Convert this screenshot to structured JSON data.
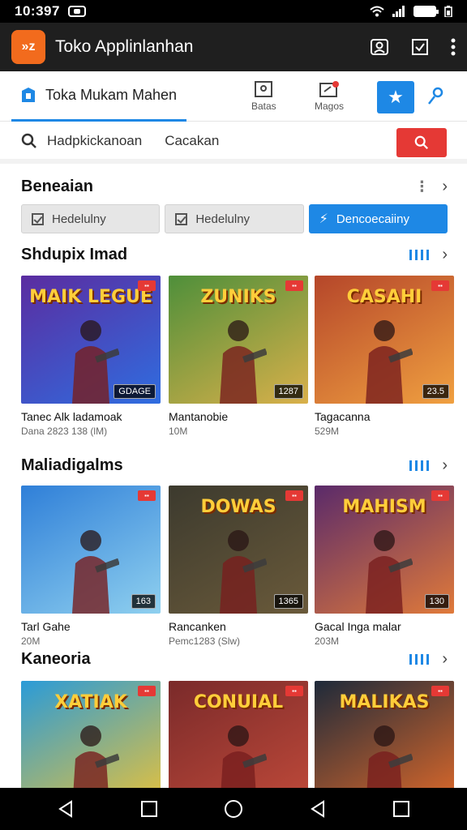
{
  "status": {
    "time": "10:397"
  },
  "app": {
    "title": "Toko Applinlanhan",
    "logo_text": "»z"
  },
  "tabs": {
    "active_label": "Toka Mukam Mahen",
    "batas_label": "Batas",
    "magos_label": "Magos"
  },
  "search": {
    "query": "Hadpkickanoan",
    "secondary": "Cacakan"
  },
  "section1": {
    "title": "Beneaian",
    "filters": [
      "Hedelulny",
      "Hedelulny",
      "Dencoecaiiny"
    ]
  },
  "section2": {
    "title": "Shdupix Imad",
    "cards": [
      {
        "name": "Tanec Alk ladamoak",
        "meta": "Dana 2823 138 (lM)",
        "logo": "MAIK LEGUE",
        "rating": "GDAGE",
        "colors": [
          "#5b2ca0",
          "#2f6de0"
        ]
      },
      {
        "name": "Mantanobie",
        "meta": "10M",
        "logo": "ZUNIKS",
        "rating": "1287",
        "colors": [
          "#4e8f3a",
          "#d9b04a"
        ]
      },
      {
        "name": "Tagacanna",
        "meta": "529M",
        "logo": "CASAHI",
        "rating": "23.5",
        "colors": [
          "#b5462a",
          "#f0a040"
        ]
      }
    ]
  },
  "section3": {
    "title": "Maliadigalms",
    "cards": [
      {
        "name": "Tarl Gahe",
        "meta": "20M",
        "logo": "",
        "rating": "163",
        "colors": [
          "#2f7fd8",
          "#8fd0ef"
        ]
      },
      {
        "name": "Rancanken",
        "meta": "Pemc1283 (Slw)",
        "logo": "DOWAS",
        "rating": "1365",
        "colors": [
          "#3c3a2e",
          "#6a5a3a"
        ]
      },
      {
        "name": "Gacal Inga malar",
        "meta": "203M",
        "logo": "MAHISM",
        "rating": "130",
        "colors": [
          "#5a2a6a",
          "#e07a3a"
        ]
      }
    ]
  },
  "section4": {
    "title": "Kaneoria",
    "cards": [
      {
        "name": "",
        "meta": "",
        "logo": "XATIAK",
        "rating": "",
        "colors": [
          "#2a9bd8",
          "#e8c23a"
        ]
      },
      {
        "name": "",
        "meta": "",
        "logo": "CONUIAL",
        "rating": "",
        "colors": [
          "#7a2a2a",
          "#c04a3a"
        ]
      },
      {
        "name": "",
        "meta": "",
        "logo": "MALIKAS",
        "rating": "",
        "colors": [
          "#1e2a3a",
          "#e06a2a"
        ]
      }
    ]
  }
}
